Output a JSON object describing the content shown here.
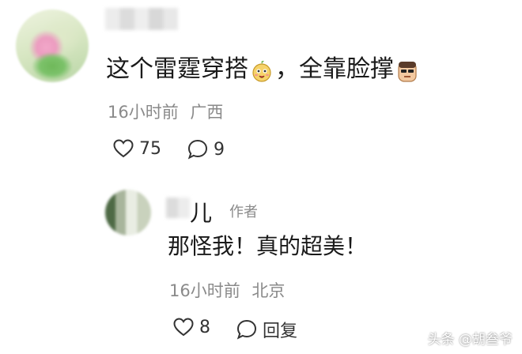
{
  "comment": {
    "username": "",
    "text_part1": "这个雷霆穿搭",
    "emoji1": "smile-emoji-icon",
    "text_part2": "，全靠脸撑",
    "emoji2": "face-emoji-icon",
    "time": "16小时前",
    "location": "广西",
    "likes": "75",
    "replies": "9"
  },
  "reply": {
    "username": "儿",
    "author_tag": "作者",
    "text": "那怪我！真的超美！",
    "time": "16小时前",
    "location": "北京",
    "likes": "8",
    "reply_label": "回复"
  },
  "watermark": "头条 @胡叁爷",
  "colors": {
    "text": "#1a1a1a",
    "meta": "#8a8a8a",
    "background": "#ffffff"
  }
}
